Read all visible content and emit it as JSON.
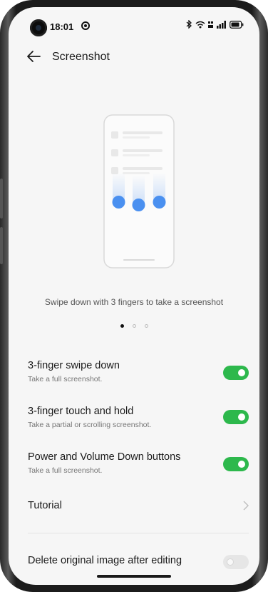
{
  "status_bar": {
    "time": "18:01"
  },
  "header": {
    "title": "Screenshot"
  },
  "illustration": {
    "caption": "Swipe down with 3 fingers to take a screenshot"
  },
  "pager": {
    "count": 3,
    "active": 0
  },
  "settings": [
    {
      "title": "3-finger swipe down",
      "subtitle": "Take a full screenshot.",
      "enabled": true
    },
    {
      "title": "3-finger touch and hold",
      "subtitle": "Take a partial or scrolling screenshot.",
      "enabled": true
    },
    {
      "title": "Power and Volume Down buttons",
      "subtitle": "Take a full screenshot.",
      "enabled": true
    }
  ],
  "tutorial": {
    "label": "Tutorial"
  },
  "delete_original": {
    "label": "Delete original image after editing",
    "enabled": false
  },
  "colors": {
    "accent": "#2db84c",
    "toggle_off": "#e6e6e6",
    "illustration_blue": "#4a90f0"
  }
}
